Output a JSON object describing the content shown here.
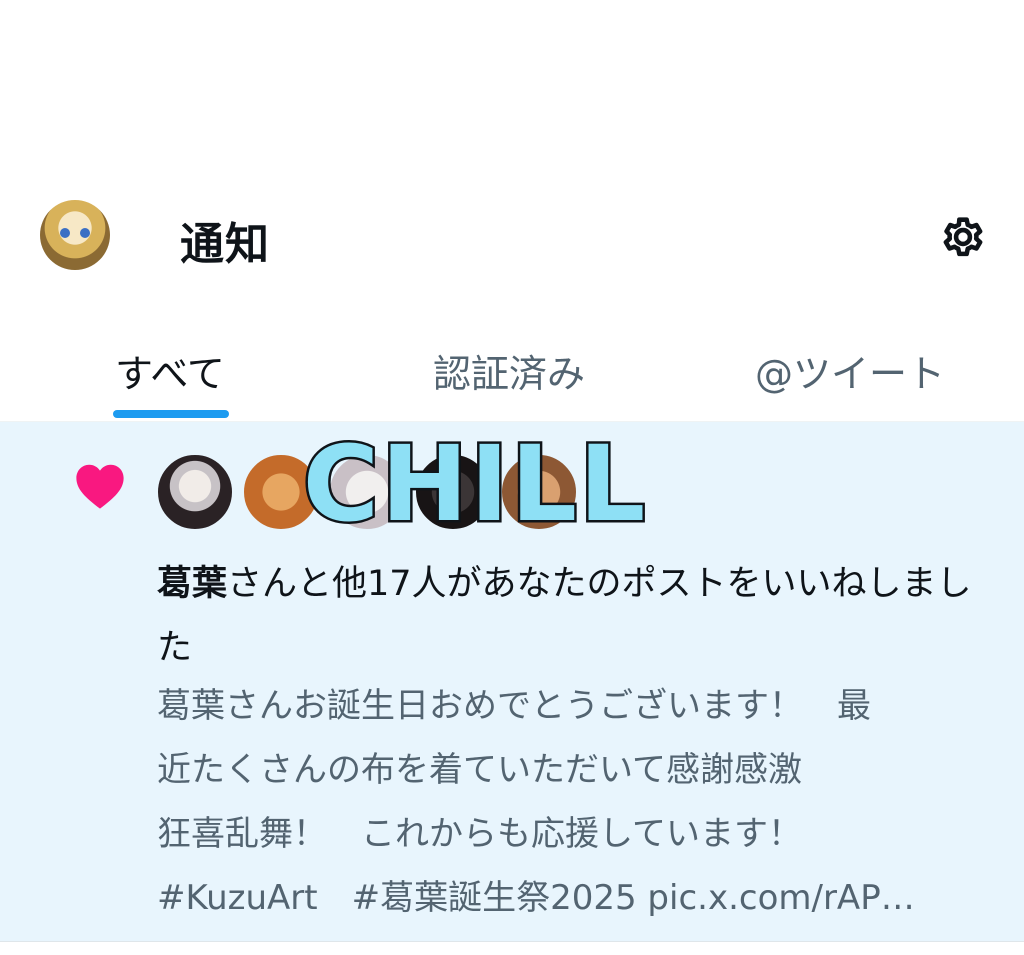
{
  "header": {
    "title": "通知",
    "settings_icon": "gear-icon",
    "avatar_icon": "user-avatar"
  },
  "tabs": [
    {
      "label": "すべて",
      "active": true
    },
    {
      "label": "認証済み",
      "active": false
    },
    {
      "label": "@ツイート",
      "active": false
    }
  ],
  "notification": {
    "type_icon": "heart-icon",
    "actor": "葛葉",
    "action": "さんと他17人があなたのポストをいいねしました",
    "post_lines": [
      "葛葉さんお誕生日おめでとうございます！　最",
      "近たくさんの布を着ていただいて感謝感激",
      "狂喜乱舞！　これからも応援しています！",
      "#KuzuArt　#葛葉誕生祭2025 pic.x.com/rAP…"
    ],
    "sticker_text": "CHILL"
  },
  "colors": {
    "accent": "#1d9bf0",
    "like": "#f91880",
    "highlight_bg": "#e8f5fd",
    "secondary_text": "#536471"
  }
}
